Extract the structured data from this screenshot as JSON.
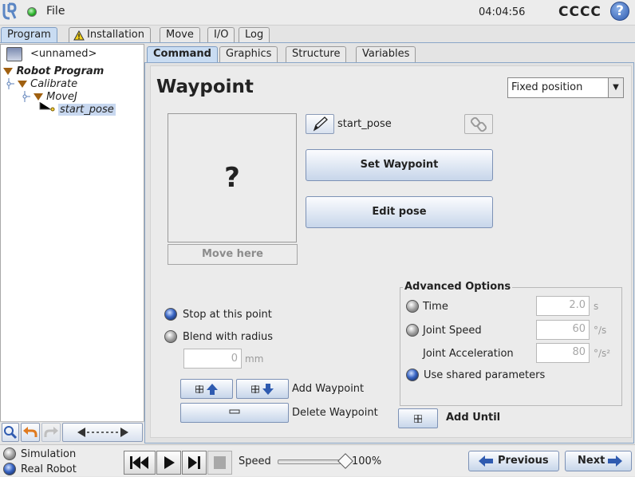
{
  "header": {
    "file_menu": "File",
    "clock": "04:04:56",
    "robot_name": "CCCC",
    "help": "?"
  },
  "main_tabs": [
    "Program",
    "Installation",
    "Move",
    "I/O",
    "Log"
  ],
  "program": {
    "name": "<unnamed>"
  },
  "tree": {
    "root": "Robot Program",
    "calibrate": "Calibrate",
    "movej": "MoveJ",
    "waypoint": "start_pose"
  },
  "sub_tabs": [
    "Command",
    "Graphics",
    "Structure",
    "Variables"
  ],
  "waypoint_panel": {
    "title": "Waypoint",
    "position_type": "Fixed position",
    "preview_symbol": "?",
    "move_here": "Move here",
    "name": "start_pose",
    "set_waypoint": "Set Waypoint",
    "edit_pose": "Edit pose",
    "stop_label": "Stop at this point",
    "blend_label": "Blend with radius",
    "blend_value": "0",
    "blend_unit": "mm",
    "add_waypoint": "Add Waypoint",
    "delete_waypoint": "Delete Waypoint",
    "add_until": "Add Until",
    "advanced": {
      "title": "Advanced Options",
      "time_label": "Time",
      "time_value": "2.0",
      "time_unit": "s",
      "speed_label": "Joint Speed",
      "speed_value": "60",
      "speed_unit": "°/s",
      "accel_label": "Joint Acceleration",
      "accel_value": "80",
      "accel_unit": "°/s²",
      "shared_label": "Use shared parameters"
    }
  },
  "footer": {
    "simulation": "Simulation",
    "real_robot": "Real Robot",
    "speed_label": "Speed",
    "speed_value": "100%",
    "speed_fraction": 1.0,
    "previous": "Previous",
    "next": "Next"
  },
  "colors": {
    "accent_blue": "#2f5bb0",
    "tab_active": "#c9dcf2",
    "tree_triangle": "#a06010",
    "status_green": "#2bb32b"
  },
  "icons": [
    "ur-logo-icon",
    "status-dot-icon",
    "help-icon",
    "warning-icon",
    "save-icon",
    "pencil-icon",
    "link-icon",
    "search-icon",
    "undo-icon",
    "redo-icon",
    "cut-icon",
    "move-up-icon",
    "move-down-icon",
    "delete-icon",
    "add-icon",
    "rewind-icon",
    "play-icon",
    "step-icon",
    "stop-icon",
    "arrow-left-icon",
    "arrow-right-icon"
  ]
}
